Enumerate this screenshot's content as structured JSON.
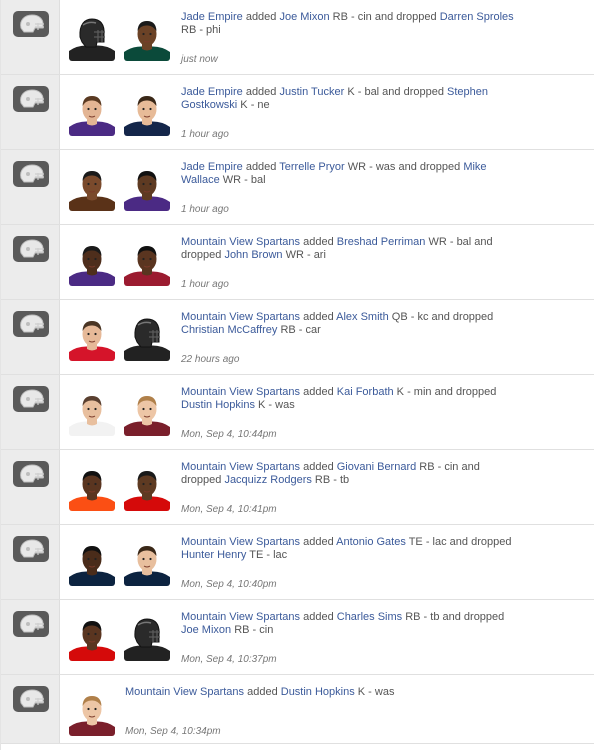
{
  "colors": {
    "link": "#3b5a9a",
    "rail": "#ececec",
    "badge": "#5a5a5a"
  },
  "icons": {
    "team_badge": "helmet-icon"
  },
  "transactions": [
    {
      "team": "Jade Empire",
      "verb1": " added ",
      "player_added": "Joe Mixon",
      "added_meta": " RB - cin and dropped ",
      "player_dropped": "Darren Sproles",
      "dropped_meta": " RB - phi",
      "time": "just now",
      "avatars": [
        {
          "kind": "silhouette",
          "jersey": "#222222"
        },
        {
          "kind": "player",
          "skin": "#6b4226",
          "jersey": "#0b4a3a",
          "hair": "#1a1a1a"
        }
      ]
    },
    {
      "team": "Jade Empire",
      "verb1": " added ",
      "player_added": "Justin Tucker",
      "added_meta": " K - bal and dropped ",
      "player_dropped": "Stephen Gostkowski",
      "dropped_meta": " K - ne",
      "time": "1 hour ago",
      "avatars": [
        {
          "kind": "player",
          "skin": "#e3b594",
          "jersey": "#4b2a84",
          "hair": "#5a3a22"
        },
        {
          "kind": "player",
          "skin": "#e7bb98",
          "jersey": "#14264a",
          "hair": "#3a2818"
        }
      ]
    },
    {
      "team": "Jade Empire",
      "verb1": " added ",
      "player_added": "Terrelle Pryor",
      "added_meta": " WR - was and dropped ",
      "player_dropped": "Mike Wallace",
      "dropped_meta": " WR - bal",
      "time": "1 hour ago",
      "avatars": [
        {
          "kind": "player",
          "skin": "#7a4a2c",
          "jersey": "#5a3218",
          "hair": "#1a1a1a"
        },
        {
          "kind": "player",
          "skin": "#5e3a22",
          "jersey": "#4b2a84",
          "hair": "#111111"
        }
      ]
    },
    {
      "team": "Mountain View Spartans",
      "verb1": " added ",
      "player_added": "Breshad Perriman",
      "added_meta": " WR - bal and dropped ",
      "player_dropped": "John Brown",
      "dropped_meta": " WR - ari",
      "time": "1 hour ago",
      "avatars": [
        {
          "kind": "player",
          "skin": "#4e2e1c",
          "jersey": "#4b2a84",
          "hair": "#1a1a1a"
        },
        {
          "kind": "player",
          "skin": "#5a3520",
          "jersey": "#9b1b30",
          "hair": "#111111"
        }
      ]
    },
    {
      "team": "Mountain View Spartans",
      "verb1": " added ",
      "player_added": "Alex Smith",
      "added_meta": " QB - kc and dropped ",
      "player_dropped": "Christian McCaffrey",
      "dropped_meta": " RB - car",
      "time": "22 hours ago",
      "avatars": [
        {
          "kind": "player",
          "skin": "#e6b998",
          "jersey": "#d5142a",
          "hair": "#4a3524"
        },
        {
          "kind": "silhouette",
          "jersey": "#222222"
        }
      ]
    },
    {
      "team": "Mountain View Spartans",
      "verb1": " added ",
      "player_added": "Kai Forbath",
      "added_meta": " K - min and dropped ",
      "player_dropped": "Dustin Hopkins",
      "dropped_meta": " K - was",
      "time": "Mon, Sep 4, 10:44pm",
      "avatars": [
        {
          "kind": "player",
          "skin": "#e8bf9e",
          "jersey": "#f2f2f2",
          "hair": "#5a4030"
        },
        {
          "kind": "player",
          "skin": "#edc6a6",
          "jersey": "#7a1f2b",
          "hair": "#b0804a"
        }
      ]
    },
    {
      "team": "Mountain View Spartans",
      "verb1": " added ",
      "player_added": "Giovani Bernard",
      "added_meta": " RB - cin and dropped ",
      "player_dropped": "Jacquizz Rodgers",
      "dropped_meta": " RB - tb",
      "time": "Mon, Sep 4, 10:41pm",
      "avatars": [
        {
          "kind": "player",
          "skin": "#5a3520",
          "jersey": "#fb4f14",
          "hair": "#111111"
        },
        {
          "kind": "player",
          "skin": "#5e3a22",
          "jersey": "#d50a0a",
          "hair": "#1a1a1a"
        }
      ]
    },
    {
      "team": "Mountain View Spartans",
      "verb1": " added ",
      "player_added": "Antonio Gates",
      "added_meta": " TE - lac and dropped ",
      "player_dropped": "Hunter Henry",
      "dropped_meta": " TE - lac",
      "time": "Mon, Sep 4, 10:40pm",
      "avatars": [
        {
          "kind": "player",
          "skin": "#4a2c1a",
          "jersey": "#0c2340",
          "hair": "#111111"
        },
        {
          "kind": "player",
          "skin": "#e8bf9e",
          "jersey": "#0c2340",
          "hair": "#3a2818"
        }
      ]
    },
    {
      "team": "Mountain View Spartans",
      "verb1": " added ",
      "player_added": "Charles Sims",
      "added_meta": " RB - tb and dropped ",
      "player_dropped": "Joe Mixon",
      "dropped_meta": " RB - cin",
      "time": "Mon, Sep 4, 10:37pm",
      "avatars": [
        {
          "kind": "player",
          "skin": "#5a3520",
          "jersey": "#d50a0a",
          "hair": "#111111"
        },
        {
          "kind": "silhouette",
          "jersey": "#222222"
        }
      ]
    },
    {
      "team": "Mountain View Spartans",
      "verb1": " added ",
      "player_added": "Dustin Hopkins",
      "added_meta": " K - was",
      "player_dropped": "",
      "dropped_meta": "",
      "time": "Mon, Sep 4, 10:34pm",
      "avatars": [
        {
          "kind": "player",
          "skin": "#edc6a6",
          "jersey": "#7a1f2b",
          "hair": "#b0804a"
        }
      ]
    }
  ]
}
